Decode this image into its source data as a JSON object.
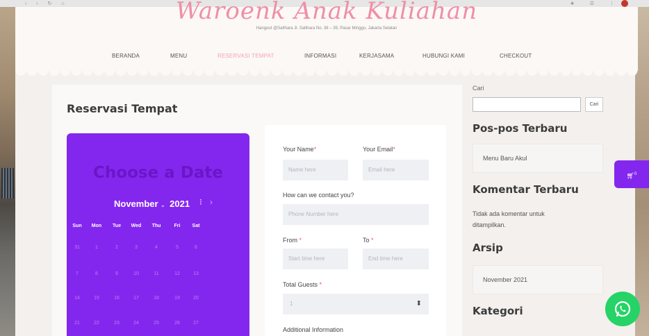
{
  "site": {
    "title": "Waroenk Anak Kuliahan",
    "address": "Hangout @Salthara Jl. Salthara No. 38 – 39, Pasar Minggu, Jakarta Selatan"
  },
  "nav": {
    "items": [
      {
        "label": "BERANDA",
        "active": false
      },
      {
        "label": "MENU",
        "active": false
      },
      {
        "label": "RESERVASI TEMPAT",
        "active": true
      },
      {
        "label": "INFORMASI",
        "active": false
      },
      {
        "label": "KERJASAMA",
        "active": false
      },
      {
        "label": "HUBUNGI KAMI",
        "active": false
      },
      {
        "label": "CHECKOUT",
        "active": false
      }
    ]
  },
  "page": {
    "heading": "Reservasi Tempat"
  },
  "calendar": {
    "title": "Choose a Date",
    "month": "November",
    "year": "2021",
    "weekdays": [
      "Sun",
      "Mon",
      "Tue",
      "Wed",
      "Thu",
      "Fri",
      "Sat"
    ],
    "weeks": [
      [
        "31",
        "1",
        "2",
        "3",
        "4",
        "5",
        "6"
      ],
      [
        "7",
        "8",
        "9",
        "10",
        "11",
        "12",
        "13"
      ],
      [
        "14",
        "15",
        "16",
        "17",
        "18",
        "19",
        "20"
      ],
      [
        "21",
        "22",
        "23",
        "24",
        "25",
        "26",
        "27"
      ]
    ],
    "color": "#8427ee"
  },
  "form": {
    "name_label": "Your Name",
    "name_placeholder": "Name here",
    "email_label": "Your Email",
    "email_placeholder": "Email here",
    "contact_label": "How can we contact you?",
    "phone_placeholder": "Phone Number here",
    "from_label": "From",
    "from_placeholder": "Start time here",
    "to_label": "To",
    "to_placeholder": "End time here",
    "guests_label": "Total Guests",
    "guests_value": "1",
    "additional_label": "Additional Information",
    "required_mark": "*"
  },
  "sidebar": {
    "search_label": "Cari",
    "search_button": "Cari",
    "recent_posts_title": "Pos-pos Terbaru",
    "recent_posts": [
      "Menu Baru Akul"
    ],
    "recent_comments_title": "Komentar Terbaru",
    "recent_comments_empty": "Tidak ada komentar untuk ditampilkan.",
    "archive_title": "Arsip",
    "archive_items": [
      "November 2021"
    ],
    "category_title": "Kategori"
  },
  "floating": {
    "cart_count": "0",
    "cart_icon": "cart-icon",
    "whatsapp_icon": "whatsapp-icon"
  }
}
